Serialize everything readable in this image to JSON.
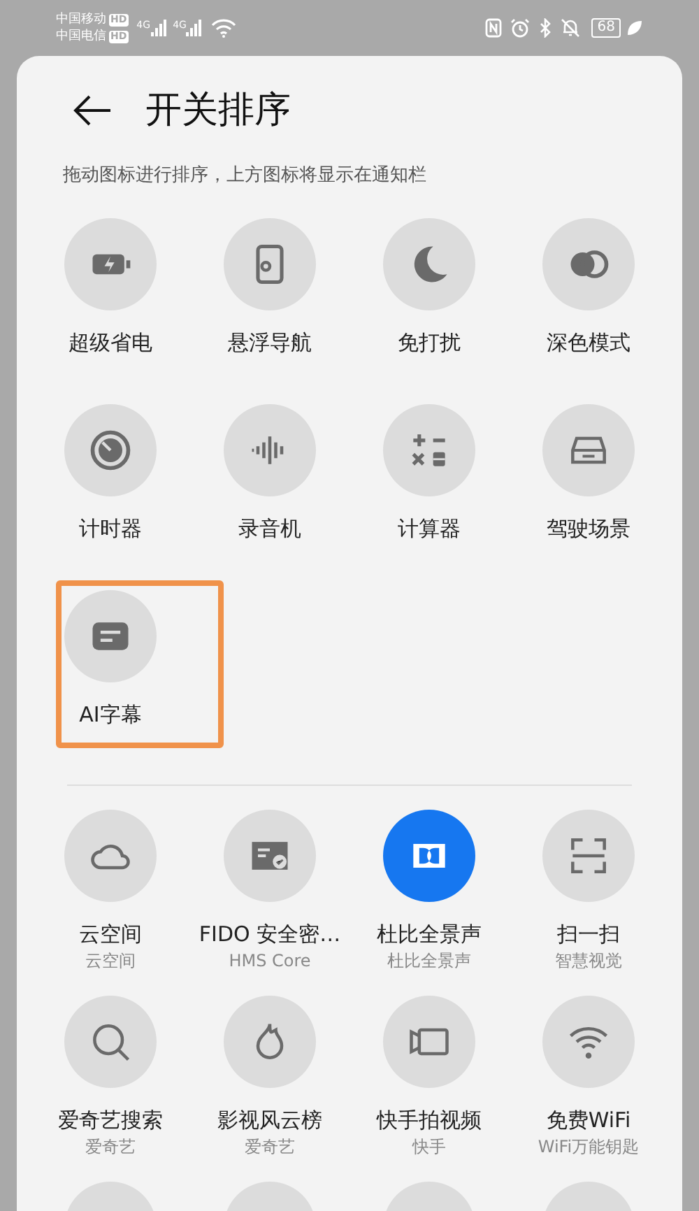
{
  "status_bar": {
    "carriers": [
      {
        "name": "中国移动",
        "badge": "HD"
      },
      {
        "name": "中国电信",
        "badge": "HD"
      }
    ],
    "networks": [
      "4G",
      "4G"
    ],
    "battery": "68"
  },
  "header": {
    "title": "开关排序",
    "hint": "拖动图标进行排序，上方图标将显示在通知栏"
  },
  "active_tiles": [
    {
      "label": "超级省电",
      "highlighted": false
    },
    {
      "label": "悬浮导航",
      "highlighted": false
    },
    {
      "label": "免打扰",
      "highlighted": false
    },
    {
      "label": "深色模式",
      "highlighted": false
    },
    {
      "label": "计时器",
      "highlighted": false
    },
    {
      "label": "录音机",
      "highlighted": false
    },
    {
      "label": "计算器",
      "highlighted": false
    },
    {
      "label": "驾驶场景",
      "highlighted": false
    },
    {
      "label": "AI字幕",
      "highlighted": true
    }
  ],
  "available_tiles": [
    {
      "label": "云空间",
      "provider": "云空间",
      "on": false
    },
    {
      "label": "FIDO 安全密…",
      "provider": "HMS Core",
      "on": false
    },
    {
      "label": "杜比全景声",
      "provider": "杜比全景声",
      "on": true
    },
    {
      "label": "扫一扫",
      "provider": "智慧视觉",
      "on": false
    },
    {
      "label": "爱奇艺搜索",
      "provider": "爱奇艺",
      "on": false
    },
    {
      "label": "影视风云榜",
      "provider": "爱奇艺",
      "on": false
    },
    {
      "label": "快手拍视频",
      "provider": "快手",
      "on": false
    },
    {
      "label": "免费WiFi",
      "provider": "WiFi万能钥匙",
      "on": false
    }
  ]
}
